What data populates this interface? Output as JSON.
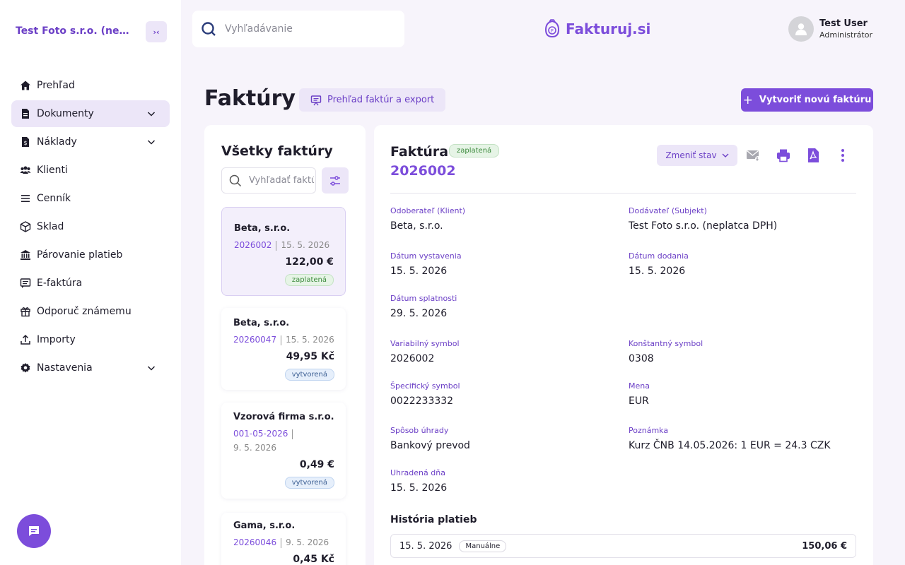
{
  "sidebar": {
    "company": "Test Foto s.r.o. (neplatca DPH)",
    "items": [
      {
        "label": "Prehľad",
        "icon": "home-icon"
      },
      {
        "label": "Dokumenty",
        "icon": "document-icon",
        "expandable": true,
        "active": true
      },
      {
        "label": "Náklady",
        "icon": "receipt-icon",
        "expandable": true
      },
      {
        "label": "Klienti",
        "icon": "users-icon"
      },
      {
        "label": "Cenník",
        "icon": "list-icon"
      },
      {
        "label": "Sklad",
        "icon": "box-icon"
      },
      {
        "label": "Párovanie platieb",
        "icon": "bank-icon"
      },
      {
        "label": "E-faktúra",
        "icon": "message-icon"
      },
      {
        "label": "Odporuč známemu",
        "icon": "gift-icon"
      },
      {
        "label": "Importy",
        "icon": "upload-icon"
      },
      {
        "label": "Nastavenia",
        "icon": "settings-icon",
        "expandable": true
      }
    ]
  },
  "header": {
    "search_placeholder": "Vyhľadávanie",
    "logo": "Fakturuj.si",
    "user_name": "Test User",
    "user_role": "Administrátor"
  },
  "page": {
    "title": "Faktúry",
    "overview_button": "Prehľad faktúr a export",
    "create_button": "Vytvoriť novú faktúru"
  },
  "list": {
    "title": "Všetky faktúry",
    "search_placeholder": "Vyhľadať faktúru",
    "invoices": [
      {
        "client": "Beta, s.r.o.",
        "number": "2026002",
        "date": "15. 5. 2026",
        "amount": "122,00 €",
        "status": "zaplatená"
      },
      {
        "client": "Beta, s.r.o.",
        "number": "20260047",
        "date": "15. 5. 2026",
        "amount": "49,95 Kč",
        "status": "vytvorená"
      },
      {
        "client": "Vzorová firma s.r.o.",
        "number": "001-05-2026",
        "date": "9. 5. 2026",
        "amount": "0,49 €",
        "status": "vytvorená"
      },
      {
        "client": "Gama, s.r.o.",
        "number": "20260046",
        "date": "9. 5. 2026",
        "amount": "0,45 Kč",
        "status": ""
      }
    ]
  },
  "detail": {
    "label": "Faktúra",
    "status": "zaplatená",
    "number": "2026002",
    "change_status": "Zmeniť stav",
    "fields": {
      "customer_label": "Odoberateľ (Klient)",
      "customer": "Beta, s.r.o.",
      "supplier_label": "Dodávateľ (Subjekt)",
      "supplier": "Test Foto s.r.o. (neplatca DPH)",
      "issue_label": "Dátum vystavenia",
      "issue": "15. 5. 2026",
      "delivery_label": "Dátum dodania",
      "delivery": "15. 5. 2026",
      "due_label": "Dátum splatnosti",
      "due": "29. 5. 2026",
      "vs_label": "Variabilný symbol",
      "vs": "2026002",
      "ks_label": "Konštantný symbol",
      "ks": "0308",
      "ss_label": "Špecifický symbol",
      "ss": "0022233332",
      "currency_label": "Mena",
      "currency": "EUR",
      "payment_label": "Spôsob úhrady",
      "payment": "Bankový prevod",
      "note_label": "Poznámka",
      "note": "Kurz ČNB 14.05.2026: 1 EUR = 24.3 CZK",
      "paid_label": "Uhradená dňa",
      "paid": "15. 5. 2026"
    },
    "history_title": "História platieb",
    "history": [
      {
        "date": "15. 5. 2026",
        "method": "Manuálne",
        "amount": "150,06 €"
      }
    ]
  }
}
